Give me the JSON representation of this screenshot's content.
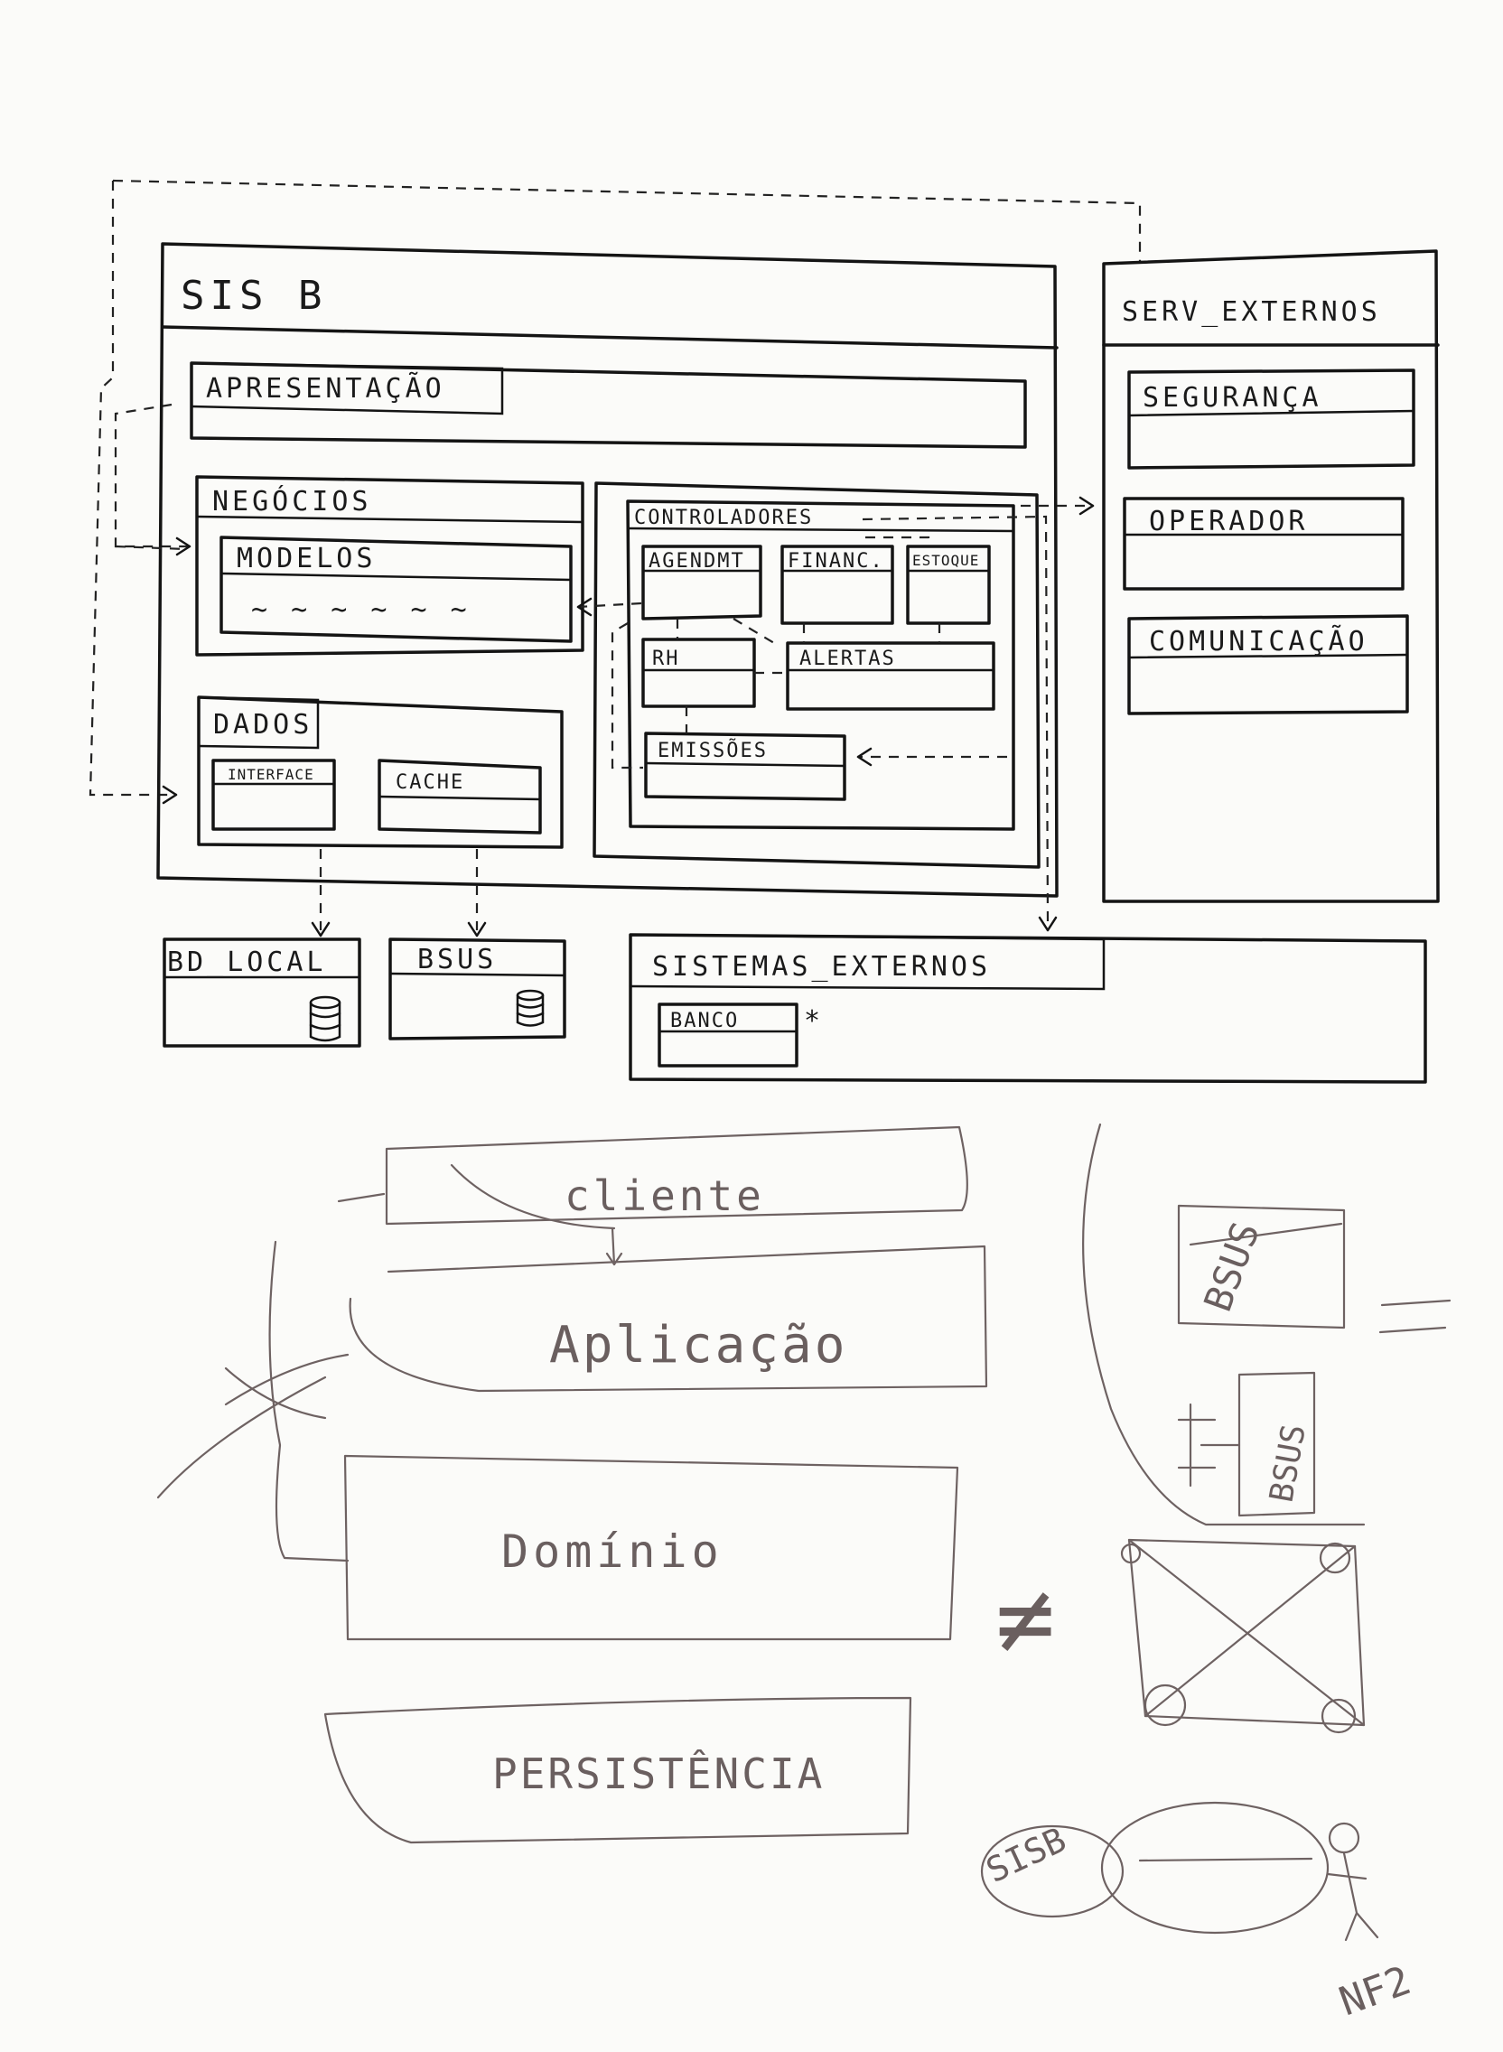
{
  "diagram": {
    "sisb": {
      "title": "SIS B",
      "apresentacao": "APRESENTAÇÃO",
      "negocios": "NEGÓCIOS",
      "modelos": "MODELOS",
      "modelos_squiggle": "~ ~ ~ ~ ~ ~",
      "controladores": {
        "title": "CONTROLADORES",
        "agendmt": "AGENDMT",
        "financ": "FINANC.",
        "estoque": "ESTOQUE",
        "rh": "RH",
        "alertas": "ALERTAS",
        "emissoes": "EMISSÕES"
      },
      "dados": {
        "title": "DADOS",
        "interface": "INTERFACE",
        "cache": "CACHE"
      }
    },
    "serv_externos": {
      "title": "SERV_EXTERNOS",
      "seguranca": "SEGURANÇA",
      "operador": "OPERADOR",
      "comunicacao": "COMUNICAÇÃO"
    },
    "bd_local": "BD_LOCAL",
    "bsus": "BSUS",
    "sistemas_externos": {
      "title": "SISTEMAS_EXTERNOS",
      "banco": "BANCO",
      "asterisk": "*"
    }
  },
  "sketch": {
    "cliente": "cliente",
    "aplicacao": "Aplicação",
    "dominio": "Domínio",
    "persistencia": "PERSISTÊNCIA",
    "bsus_a": "BSUS",
    "bsus_b": "BSUS",
    "not_equal": "≠",
    "sisb": "SISB",
    "nf2": "NF2"
  },
  "colors": {
    "ink": "#141414",
    "pencil": "#6e6262",
    "paper": "#fbfbf9"
  }
}
